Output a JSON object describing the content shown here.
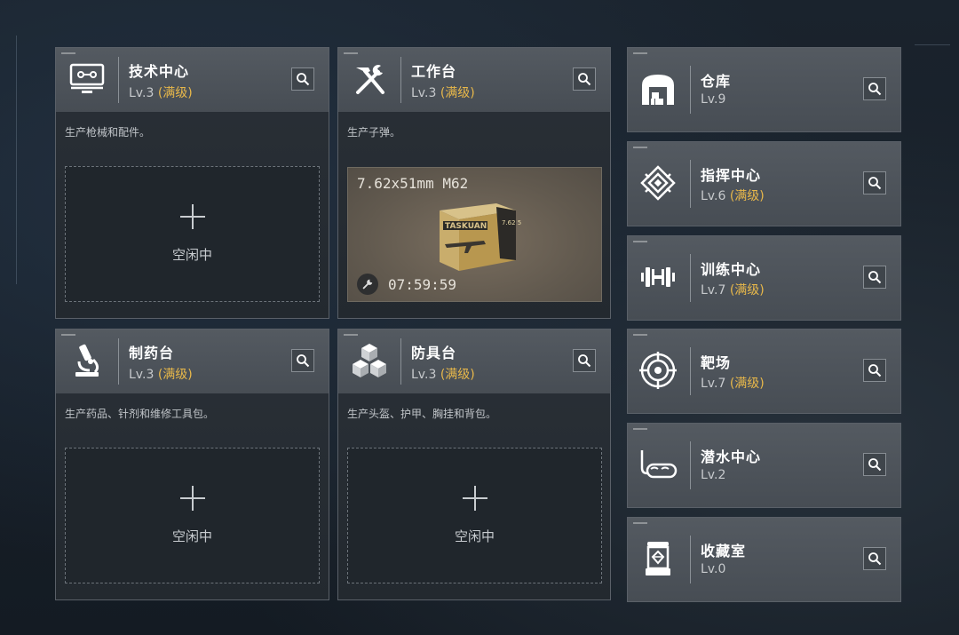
{
  "colors": {
    "max_level": "#e8b84a",
    "card_header": "#4d535a",
    "panel": "#262c32"
  },
  "big_cards": [
    {
      "id": "tech",
      "title": "技术中心",
      "level": "Lv.3",
      "max_tag": "(满级)",
      "desc": "生产枪械和配件。",
      "icon": "computer-icon",
      "slot": {
        "state": "空闲中"
      }
    },
    {
      "id": "workbench",
      "title": "工作台",
      "level": "Lv.3",
      "max_tag": "(满级)",
      "desc": "生产子弹。",
      "icon": "hammer-wrench-icon",
      "production": {
        "item": "7.62x51mm M62",
        "box_text": "TASKUAN",
        "box_code": "7.62 51",
        "time_left": "07:59:59"
      }
    },
    {
      "id": "pharmacy",
      "title": "制药台",
      "level": "Lv.3",
      "max_tag": "(满级)",
      "desc": "生产药品、针剂和维修工具包。",
      "icon": "microscope-icon",
      "slot": {
        "state": "空闲中"
      }
    },
    {
      "id": "armor",
      "title": "防具台",
      "level": "Lv.3",
      "max_tag": "(满级)",
      "desc": "生产头盔、护甲、胸挂和背包。",
      "icon": "cubes-icon",
      "slot": {
        "state": "空闲中"
      }
    }
  ],
  "small_cards": [
    {
      "id": "warehouse",
      "title": "仓库",
      "level": "Lv.9",
      "max_tag": "",
      "icon": "warehouse-icon"
    },
    {
      "id": "command",
      "title": "指挥中心",
      "level": "Lv.6",
      "max_tag": "(满级)",
      "icon": "command-chip-icon"
    },
    {
      "id": "training",
      "title": "训练中心",
      "level": "Lv.7",
      "max_tag": "(满级)",
      "icon": "dumbbell-icon"
    },
    {
      "id": "range",
      "title": "靶场",
      "level": "Lv.7",
      "max_tag": "(满级)",
      "icon": "target-icon"
    },
    {
      "id": "dive",
      "title": "潜水中心",
      "level": "Lv.2",
      "max_tag": "",
      "icon": "diving-mask-icon"
    },
    {
      "id": "collection",
      "title": "收藏室",
      "level": "Lv.0",
      "max_tag": "",
      "icon": "display-case-icon"
    }
  ]
}
